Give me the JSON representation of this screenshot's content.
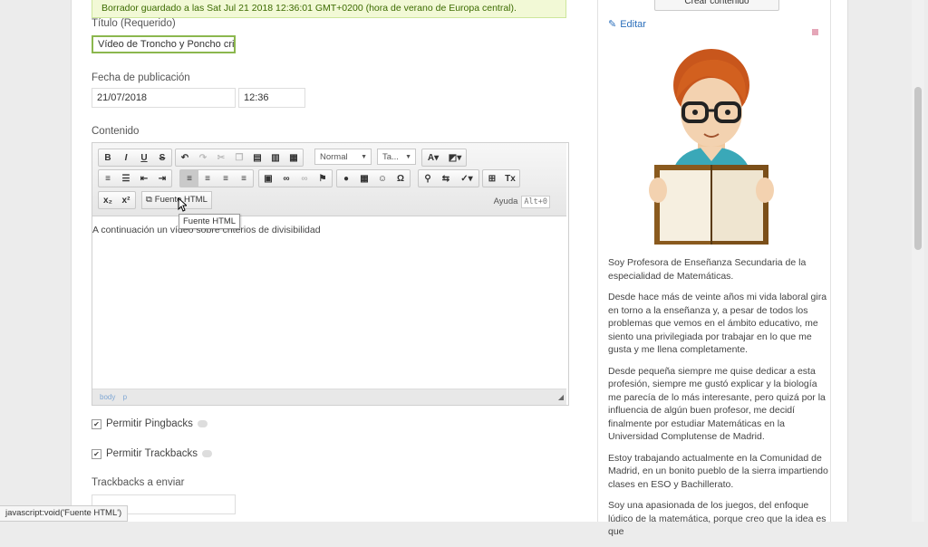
{
  "notice": "Borrador guardado a las Sat Jul 21 2018 12:36:01 GMT+0200 (hora de verano de Europa central).",
  "title_field": {
    "label": "Título (Requerido)",
    "value": "Vídeo de Troncho y Poncho criter"
  },
  "publish": {
    "label": "Fecha de publicación",
    "date": "21/07/2018",
    "time": "12:36"
  },
  "content": {
    "label": "Contenido",
    "format_combo": "Normal",
    "size_combo": "Ta...",
    "source_button": "Fuente HTML",
    "help_label": "Ayuda",
    "help_key": "Alt+0",
    "tooltip": "Fuente HTML",
    "body_text": "A continuación un vídeo sobre criterios de divisibilidad",
    "path_body": "body",
    "path_p": "p"
  },
  "options": {
    "pingbacks": "Permitir Pingbacks",
    "trackbacks": "Permitir Trackbacks",
    "trackbacks_send": "Trackbacks a enviar"
  },
  "status_bar": "javascript:void('Fuente HTML')",
  "sidebar": {
    "create_button": "Crear contenido",
    "edit_link": "Editar",
    "bio": [
      "Soy Profesora de Enseñanza Secundaria de la especialidad de Matemáticas.",
      "Desde hace más de veinte años mi vida laboral gira en torno a la enseñanza y, a pesar de todos los problemas que vemos en el ámbito educativo, me siento una privilegiada por trabajar en lo que me gusta y me llena completamente.",
      "Desde pequeña siempre me quise dedicar a esta profesión, siempre me gustó explicar y la biología me parecía de lo más interesante, pero quizá por la influencia de algún buen profesor, me decidí finalmente por estudiar Matemáticas en la Universidad Complutense de Madrid.",
      "Estoy trabajando actualmente en la Comunidad de Madrid, en un bonito pueblo de la sierra impartiendo clases en ESO y Bachillerato.",
      "Soy una apasionada de los juegos, del enfoque lúdico de la matemática, porque creo que la idea es que"
    ]
  },
  "colors": {
    "notice_bg": "#f2f9d6",
    "notice_border": "#cde69c",
    "link": "#2a6ebb",
    "title_border": "#8bb74e"
  },
  "icons": [
    "bold-icon",
    "italic-icon",
    "underline-icon",
    "strike-icon",
    "undo-icon",
    "redo-icon",
    "cut-icon",
    "copy-icon",
    "paste-icon",
    "paste-text-icon",
    "paste-word-icon",
    "font-color-icon",
    "bg-color-icon",
    "numbered-list-icon",
    "bulleted-list-icon",
    "outdent-icon",
    "indent-icon",
    "align-left-icon",
    "align-center-icon",
    "align-right-icon",
    "justify-icon",
    "image-icon",
    "link-icon",
    "unlink-icon",
    "anchor-icon",
    "flash-icon",
    "table-icon",
    "smiley-icon",
    "special-char-icon",
    "find-icon",
    "replace-icon",
    "spellcheck-icon",
    "page-break-icon",
    "remove-format-icon",
    "subscript-icon",
    "superscript-icon",
    "source-icon",
    "pencil-icon"
  ]
}
